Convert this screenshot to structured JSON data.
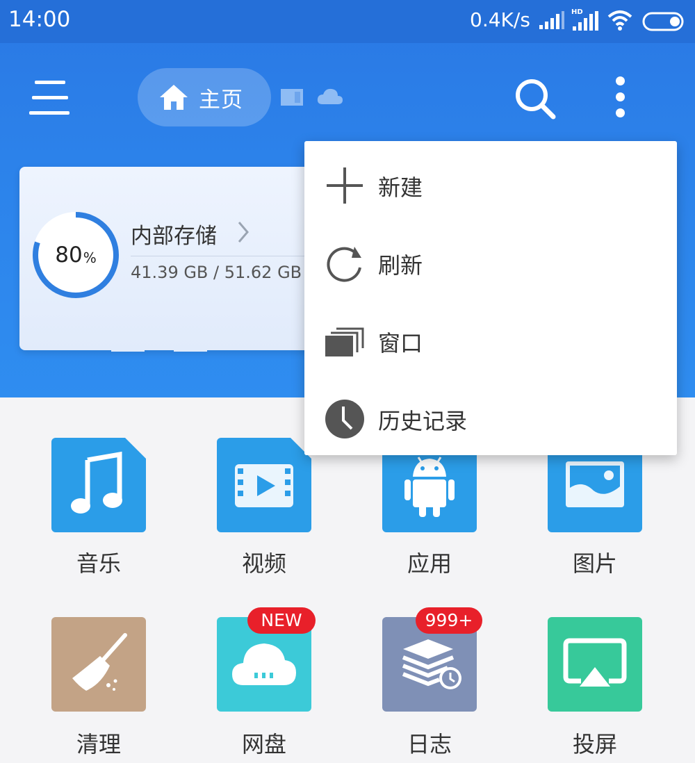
{
  "status_bar": {
    "time": "14:00",
    "network_speed": "0.4K/s",
    "hd_label": "HD",
    "icons": [
      "signal-icon",
      "hd-signal-icon",
      "wifi-icon",
      "battery-icon"
    ]
  },
  "toolbar": {
    "home_label": "主页",
    "icons": [
      "menu-icon",
      "home-icon",
      "sd-card-icon",
      "cloud-icon",
      "search-icon",
      "more-icon"
    ]
  },
  "storage": {
    "title": "内部存储",
    "percent": "80",
    "percent_sign": "%",
    "usage_fraction": 0.8,
    "size": "41.39 GB / 51.62 GB"
  },
  "popup_menu": {
    "items": [
      {
        "label": "新建",
        "icon": "plus-icon"
      },
      {
        "label": "刷新",
        "icon": "refresh-icon"
      },
      {
        "label": "窗口",
        "icon": "windows-icon"
      },
      {
        "label": "历史记录",
        "icon": "clock-icon"
      }
    ]
  },
  "categories": [
    {
      "label": "音乐",
      "icon": "music-icon",
      "color": "#2b9de8"
    },
    {
      "label": "视频",
      "icon": "video-icon",
      "color": "#2b9de8"
    },
    {
      "label": "应用",
      "icon": "android-icon",
      "color": "#2b9de8"
    },
    {
      "label": "图片",
      "icon": "image-icon",
      "color": "#2b9de8"
    },
    {
      "label": "清理",
      "icon": "broom-icon",
      "color": "#c3a386"
    },
    {
      "label": "网盘",
      "icon": "cloud-drive-icon",
      "color": "#3ccad8",
      "badge": "NEW"
    },
    {
      "label": "日志",
      "icon": "log-icon",
      "color": "#7f90b6",
      "badge": "999+"
    },
    {
      "label": "投屏",
      "icon": "cast-screen-icon",
      "color": "#37c99a"
    }
  ],
  "colors": {
    "header_blue": "#2c82ea",
    "ring_blue": "#2f7fe0",
    "badge_red": "#e8202a"
  }
}
